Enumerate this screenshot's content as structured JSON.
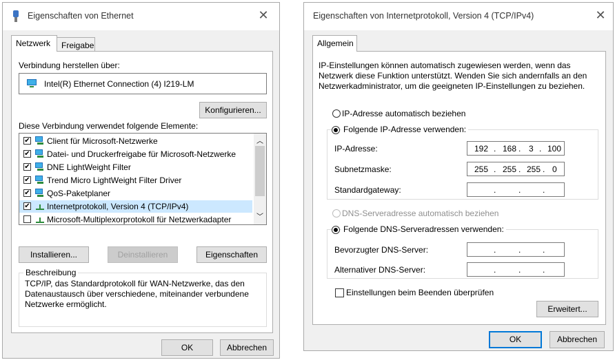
{
  "left_dialog": {
    "title": "Eigenschaften von Ethernet",
    "tabs": [
      {
        "label": "Netzwerk",
        "active": true
      },
      {
        "label": "Freigabe",
        "active": false
      }
    ],
    "connect_via_label": "Verbindung herstellen über:",
    "adapter_name": "Intel(R) Ethernet Connection (4) I219-LM",
    "configure_button": "Konfigurieren...",
    "elements_label": "Diese Verbindung verwendet folgende Elemente:",
    "items": [
      {
        "label": "Client für Microsoft-Netzwerke",
        "checked": true,
        "icon": "network-client-icon"
      },
      {
        "label": "Datei- und Druckerfreigabe für Microsoft-Netzwerke",
        "checked": true,
        "icon": "network-service-icon"
      },
      {
        "label": "DNE LightWeight Filter",
        "checked": true,
        "icon": "network-service-icon"
      },
      {
        "label": "Trend Micro LightWeight Filter Driver",
        "checked": true,
        "icon": "network-service-icon"
      },
      {
        "label": "QoS-Paketplaner",
        "checked": true,
        "icon": "network-service-icon"
      },
      {
        "label": "Internetprotokoll, Version 4 (TCP/IPv4)",
        "checked": true,
        "icon": "protocol-icon",
        "selected": true
      },
      {
        "label": "Microsoft-Multiplexorprotokoll für Netzwerkadapter",
        "checked": false,
        "icon": "protocol-icon"
      }
    ],
    "install_button": "Installieren...",
    "uninstall_button": "Deinstallieren",
    "properties_button": "Eigenschaften",
    "description_label": "Beschreibung",
    "description_text_line1": "TCP/IP, das Standardprotokoll für WAN-Netzwerke, das den",
    "description_text_line2": "Datenaustausch über verschiedene, miteinander verbundene",
    "description_text_line3": "Netzwerke ermöglicht.",
    "ok_button": "OK",
    "cancel_button": "Abbrechen"
  },
  "right_dialog": {
    "title": "Eigenschaften von Internetprotokoll, Version 4 (TCP/IPv4)",
    "tab": "Allgemein",
    "intro_line1": "IP-Einstellungen können automatisch zugewiesen werden, wenn das",
    "intro_line2": "Netzwerk diese Funktion unterstützt. Wenden Sie sich andernfalls an den",
    "intro_line3": "Netzwerkadministrator, um die geeigneten IP-Einstellungen zu beziehen.",
    "ip_auto_label": "IP-Adresse automatisch beziehen",
    "ip_manual_label": "Folgende IP-Adresse verwenden:",
    "ip_address_label": "IP-Adresse:",
    "ip_address": [
      "192",
      "168",
      "3",
      "100"
    ],
    "subnet_label": "Subnetzmaske:",
    "subnet": [
      "255",
      "255",
      "255",
      "0"
    ],
    "gateway_label": "Standardgateway:",
    "dns_auto_label": "DNS-Serveradresse automatisch beziehen",
    "dns_manual_label": "Folgende DNS-Serveradressen verwenden:",
    "preferred_dns_label": "Bevorzugter DNS-Server:",
    "alternate_dns_label": "Alternativer DNS-Server:",
    "validate_label": "Einstellungen beim Beenden überprüfen",
    "advanced_button": "Erweitert...",
    "ok_button": "OK",
    "cancel_button": "Abbrechen"
  },
  "colors": {
    "selection": "#cce8ff",
    "accent": "#0078d7",
    "dialog_bg": "#f0f0f0"
  }
}
